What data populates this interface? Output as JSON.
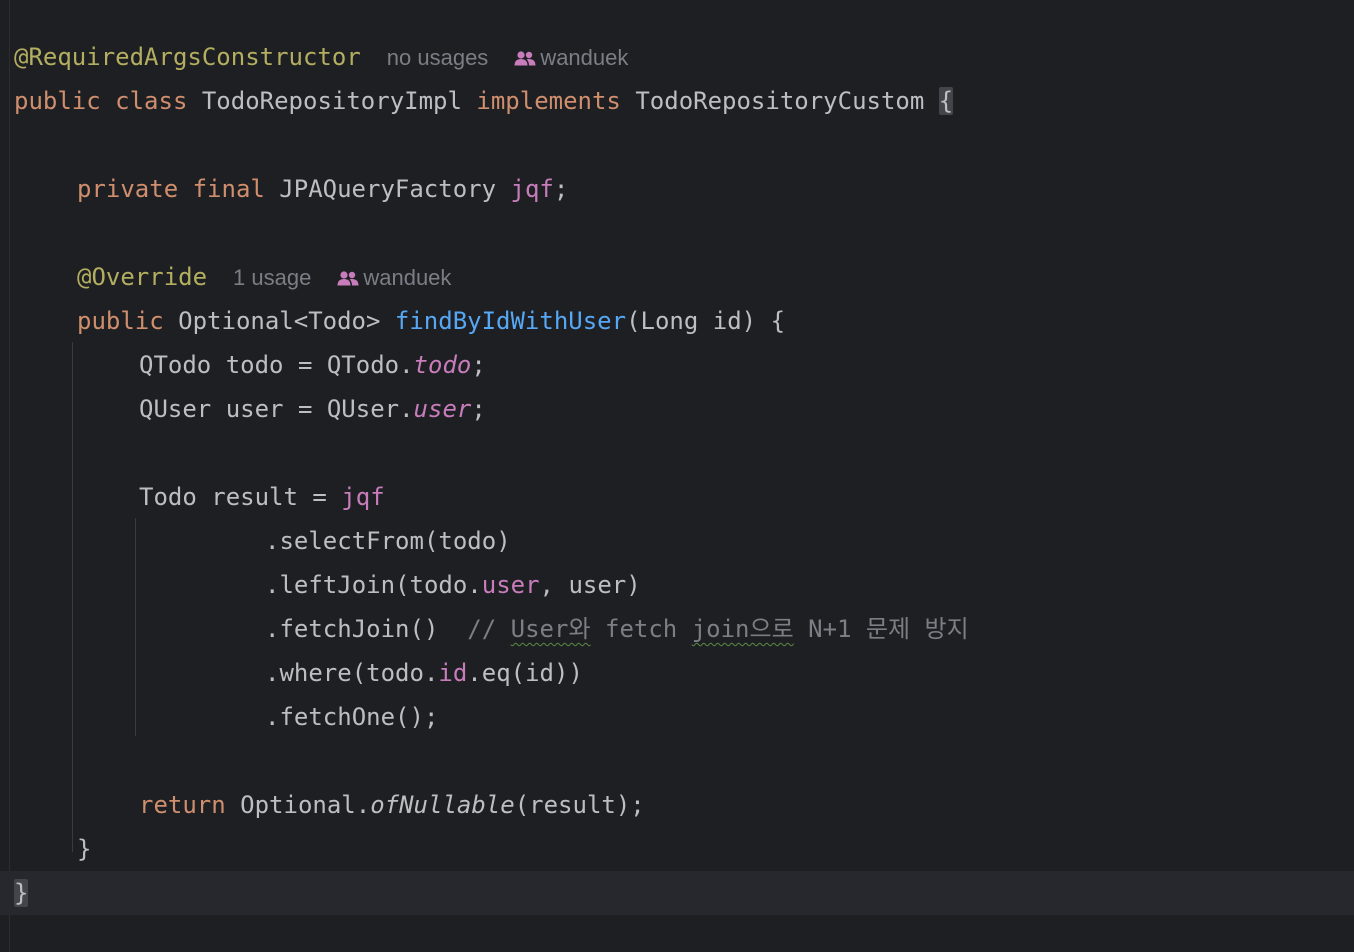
{
  "editor": {
    "lines": [
      {
        "tokens": [
          {
            "t": "@RequiredArgsConstructor",
            "c": "ann"
          }
        ],
        "usages": "no usages",
        "author": "wanduek",
        "indent": 0
      },
      {
        "tokens": [
          {
            "t": "public",
            "c": "kw"
          },
          {
            "t": " "
          },
          {
            "t": "class",
            "c": "kw"
          },
          {
            "t": " TodoRepositoryImpl "
          },
          {
            "t": "implements",
            "c": "kw"
          },
          {
            "t": " TodoRepositoryCustom "
          },
          {
            "t": "{",
            "c": "brace-hl"
          }
        ],
        "indent": 0
      },
      {
        "tokens": [],
        "indent": 0
      },
      {
        "tokens": [
          {
            "t": "private",
            "c": "kw"
          },
          {
            "t": " "
          },
          {
            "t": "final",
            "c": "kw"
          },
          {
            "t": " JPAQueryFactory "
          },
          {
            "t": "jqf",
            "c": "fld"
          },
          {
            "t": ";"
          }
        ],
        "indent": 1
      },
      {
        "tokens": [],
        "indent": 0
      },
      {
        "tokens": [
          {
            "t": "@Override",
            "c": "ann"
          }
        ],
        "usages": "1 usage",
        "author": "wanduek",
        "indent": 1
      },
      {
        "tokens": [
          {
            "t": "public",
            "c": "kw"
          },
          {
            "t": " Optional<Todo> "
          },
          {
            "t": "findByIdWithUser",
            "c": "mth"
          },
          {
            "t": "(Long id) {"
          }
        ],
        "indent": 1
      },
      {
        "tokens": [
          {
            "t": "QTodo todo = QTodo."
          },
          {
            "t": "todo",
            "c": "fldi"
          },
          {
            "t": ";"
          }
        ],
        "indent": 2
      },
      {
        "tokens": [
          {
            "t": "QUser user = QUser."
          },
          {
            "t": "user",
            "c": "fldi"
          },
          {
            "t": ";"
          }
        ],
        "indent": 2
      },
      {
        "tokens": [],
        "indent": 0
      },
      {
        "tokens": [
          {
            "t": "Todo result = "
          },
          {
            "t": "jqf",
            "c": "fld"
          }
        ],
        "indent": 2
      },
      {
        "tokens": [
          {
            "t": ".selectFrom(todo)"
          }
        ],
        "indent": 3
      },
      {
        "tokens": [
          {
            "t": ".leftJoin(todo."
          },
          {
            "t": "user",
            "c": "fld"
          },
          {
            "t": ", user)"
          }
        ],
        "indent": 3
      },
      {
        "tokens": [
          {
            "t": ".fetchJoin()  "
          },
          {
            "t": "// ",
            "c": "cmt"
          },
          {
            "t": "User와",
            "c": "cmt typo"
          },
          {
            "t": " fetch ",
            "c": "cmt"
          },
          {
            "t": "join으로",
            "c": "cmt typo"
          },
          {
            "t": " N+1 문제 방지",
            "c": "cmt"
          }
        ],
        "indent": 3
      },
      {
        "tokens": [
          {
            "t": ".where(todo."
          },
          {
            "t": "id",
            "c": "fld"
          },
          {
            "t": ".eq(id))"
          }
        ],
        "indent": 3
      },
      {
        "tokens": [
          {
            "t": ".fetchOne();"
          }
        ],
        "indent": 3
      },
      {
        "tokens": [],
        "indent": 0
      },
      {
        "tokens": [
          {
            "t": "return",
            "c": "kw"
          },
          {
            "t": " Optional."
          },
          {
            "t": "ofNullable",
            "c": "sti"
          },
          {
            "t": "(result);"
          }
        ],
        "indent": 2
      },
      {
        "tokens": [
          {
            "t": "}"
          }
        ],
        "indent": 1
      },
      {
        "tokens": [
          {
            "t": "}",
            "c": "brace-hl"
          }
        ],
        "indent": 0,
        "current": true
      }
    ]
  },
  "colors": {
    "background": "#1e1f22",
    "keyword": "#cf8e6d",
    "annotation": "#b3ae60",
    "field": "#c77dbb",
    "method": "#56a8f5",
    "comment": "#7a7e85",
    "text": "#bcbec4"
  },
  "icons": {
    "author": "people-icon"
  }
}
